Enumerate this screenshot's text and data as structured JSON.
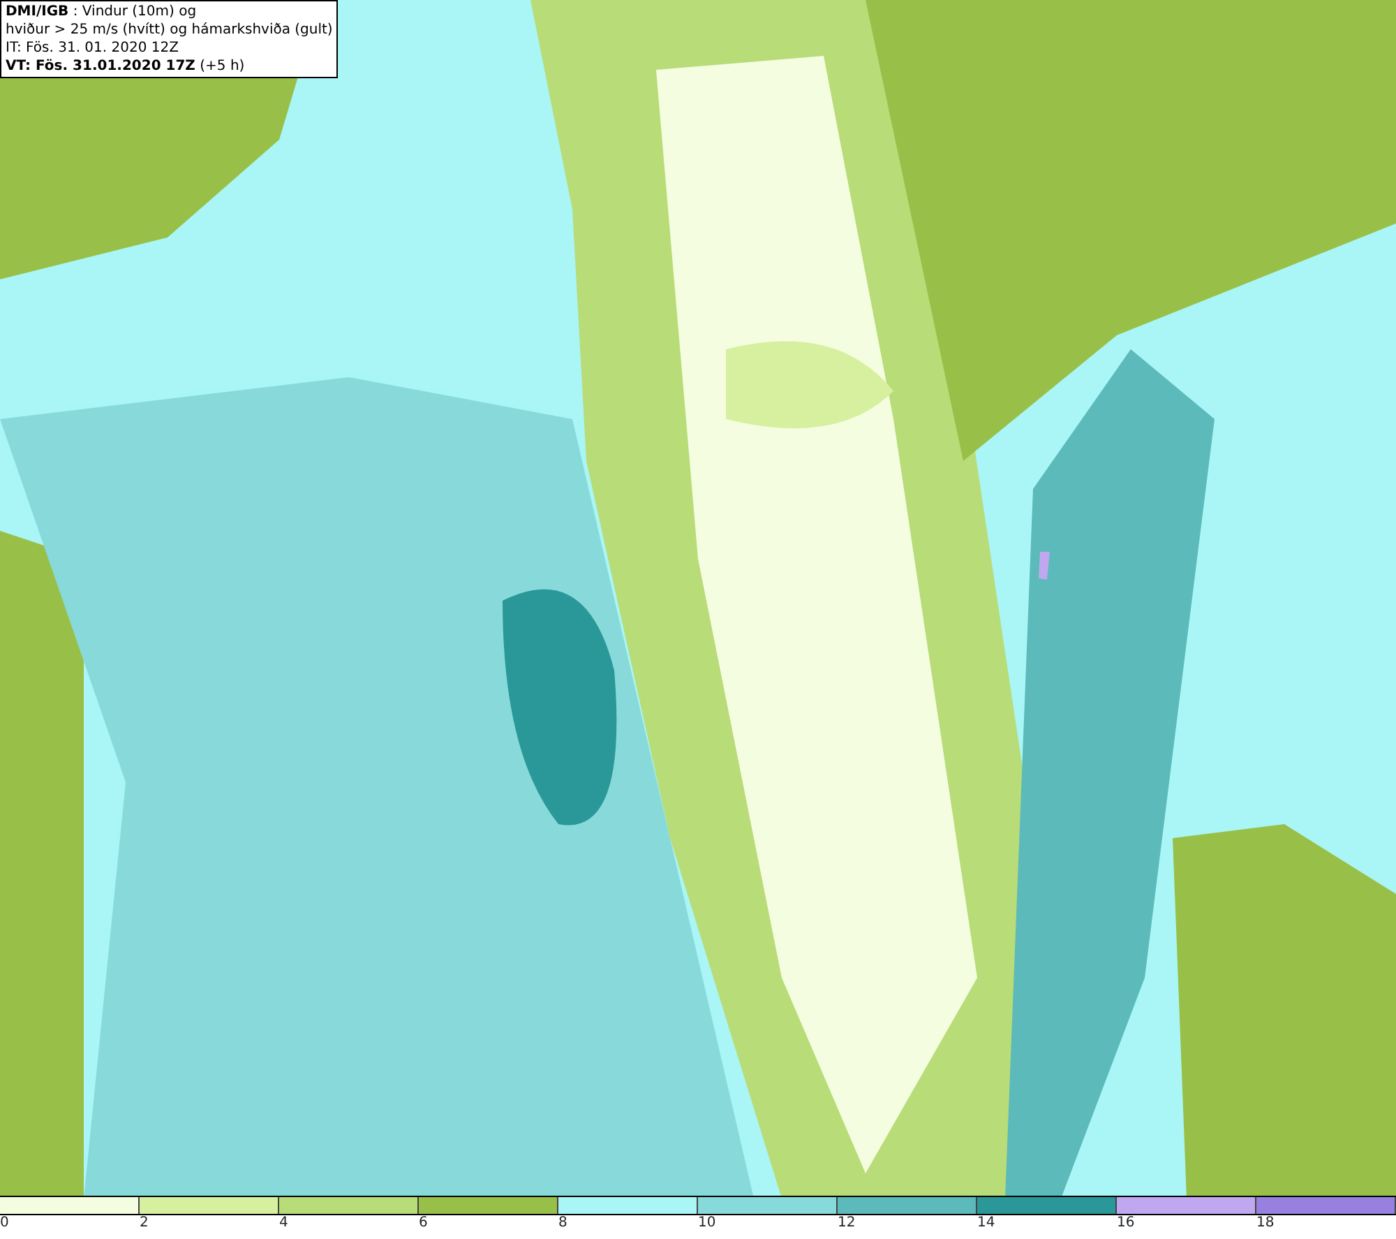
{
  "info_box": {
    "lines": [
      "**DMI/IGB** : Vindur (10m) og",
      "hviður > 25 m/s (hvítt) og hámarkshviða (gult)",
      "IT: Fös. 31. 01. 2020 12Z",
      "**VT: Fös. 31.01.2020 17Z** (+5 h)"
    ]
  },
  "legend": {
    "items": [
      {
        "label": "0",
        "color": "#f5fde0"
      },
      {
        "label": "2",
        "color": "#d6f0a0"
      },
      {
        "label": "4",
        "color": "#b8dc78"
      },
      {
        "label": "6",
        "color": "#98c048"
      },
      {
        "label": "8",
        "color": "#aaf6f6"
      },
      {
        "label": "10",
        "color": "#88dada"
      },
      {
        "label": "12",
        "color": "#5cbaba"
      },
      {
        "label": "14",
        "color": "#2a9898"
      },
      {
        "label": "16",
        "color": "#c0a8f0"
      },
      {
        "label": "18",
        "color": "#9880e0"
      }
    ]
  }
}
